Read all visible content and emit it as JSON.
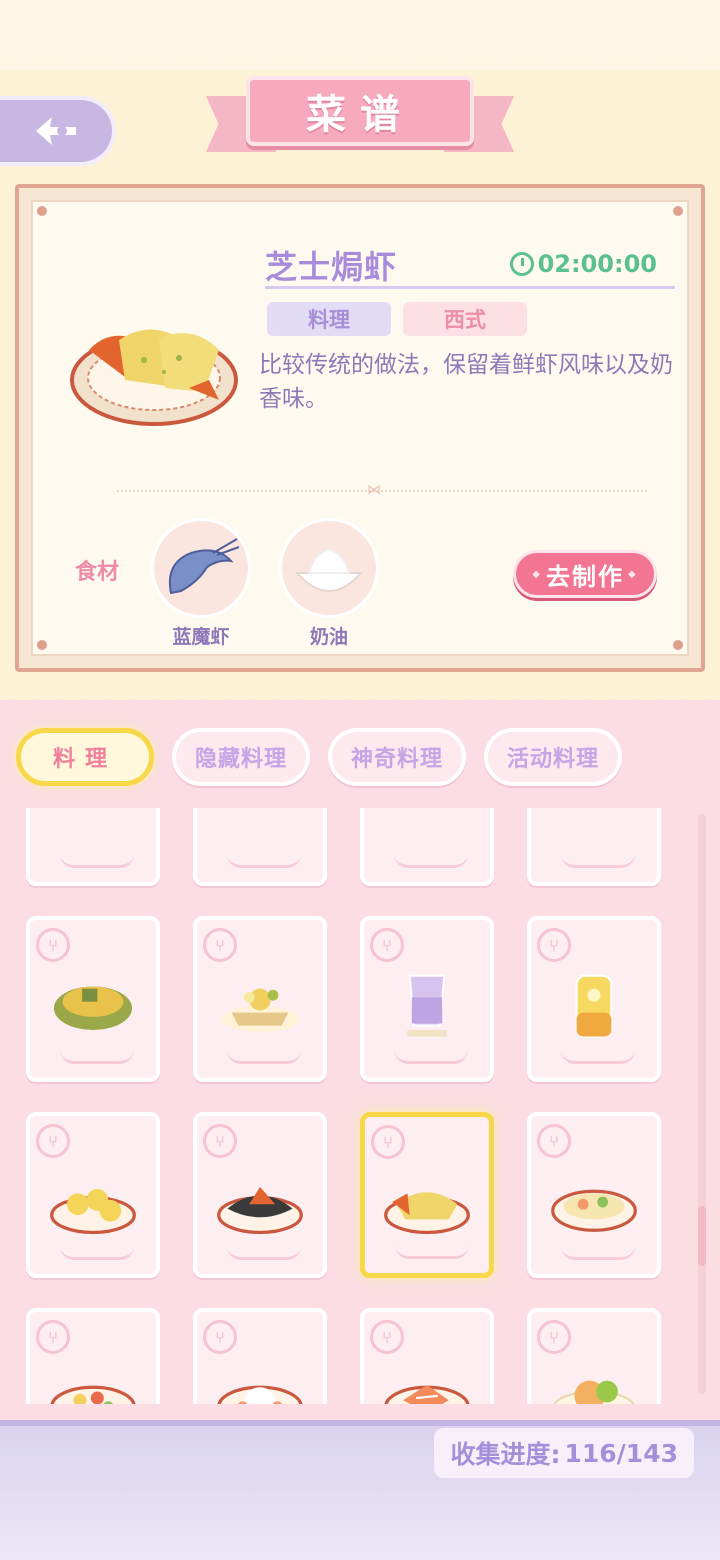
{
  "header": {
    "title": "菜谱"
  },
  "recipe": {
    "name": "芝士焗虾",
    "time": "02:00:00",
    "tags": [
      "料理",
      "西式"
    ],
    "description": "比较传统的做法，保留着鲜虾风味以及奶香味。",
    "ingredients_label": "食材",
    "ingredients": [
      {
        "name": "蓝魔虾",
        "icon": "shrimp-icon"
      },
      {
        "name": "奶油",
        "icon": "cream-icon"
      }
    ],
    "make_button": "去制作"
  },
  "tabs": [
    "料理",
    "隐藏料理",
    "神奇料理",
    "活动料理"
  ],
  "active_tab": 0,
  "grid_items": [
    "partial-dish-1",
    "partial-dish-2",
    "partial-dish-3",
    "partial-dish-4",
    "gratin-dish",
    "fruit-tart",
    "purple-drink",
    "lemon-jar",
    "shumai-plate",
    "fish-plate",
    "cheese-shrimp-plate",
    "shrimp-salad-plate",
    "salad-plate",
    "rice-plate",
    "salmon-plate",
    "fruit-plate"
  ],
  "selected_item_index": 10,
  "progress": {
    "label": "收集进度:",
    "value": "116/143"
  },
  "colors": {
    "accent_pink": "#f27593",
    "active_tab_border": "#f8d84a",
    "timer_green": "#5bbf8f",
    "title_purple": "#a88bdb"
  }
}
